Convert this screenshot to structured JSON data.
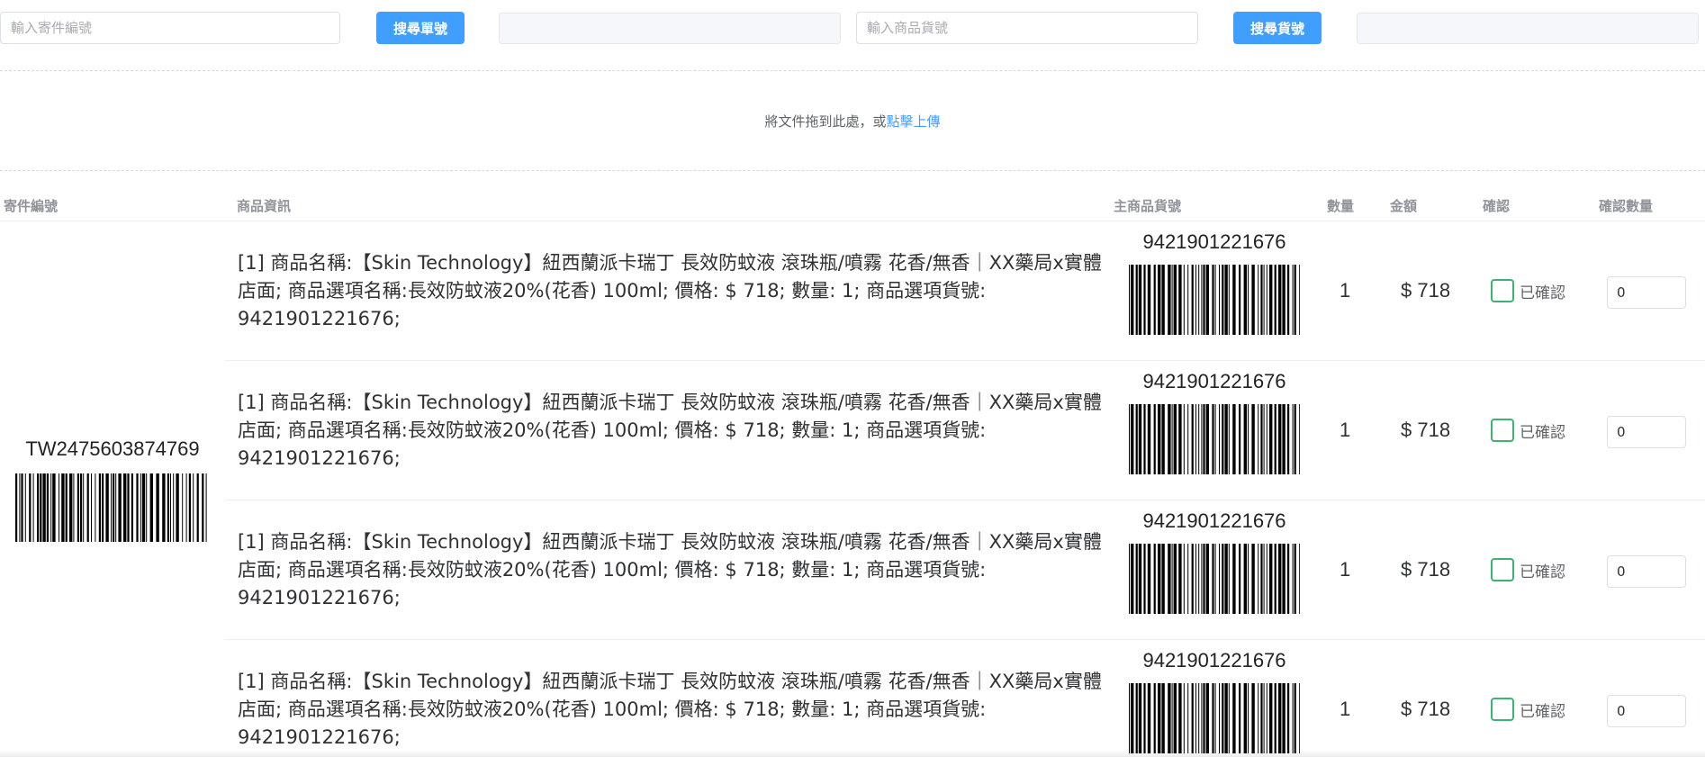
{
  "search": {
    "shipment_placeholder": "輸入寄件編號",
    "shipment_button": "搜尋單號",
    "sku_placeholder": "輸入商品貨號",
    "sku_button": "搜尋貨號"
  },
  "upload": {
    "hint": "將文件拖到此處，或",
    "link": "點擊上傳"
  },
  "table": {
    "headers": {
      "shipment_no": "寄件編號",
      "product_info": "商品資訊",
      "main_sku": "主商品貨號",
      "quantity": "數量",
      "amount": "金額",
      "confirm": "確認",
      "confirm_qty": "確認數量"
    },
    "shipment_number": "TW2475603874769",
    "rows": [
      {
        "info": "[1] 商品名稱:【Skin Technology】紐西蘭派卡瑞丁 長效防蚊液 滾珠瓶/噴霧 花香/無香｜XX藥局x實體店面; 商品選項名稱:長效防蚊液20%(花香) 100ml; 價格: $ 718; 數量: 1; 商品選項貨號: 9421901221676;",
        "sku": "9421901221676",
        "qty": "1",
        "amount": "$ 718",
        "confirm_label": "已確認",
        "confirm_qty": "0"
      },
      {
        "info": "[1] 商品名稱:【Skin Technology】紐西蘭派卡瑞丁 長效防蚊液 滾珠瓶/噴霧 花香/無香｜XX藥局x實體店面; 商品選項名稱:長效防蚊液20%(花香) 100ml; 價格: $ 718; 數量: 1; 商品選項貨號: 9421901221676;",
        "sku": "9421901221676",
        "qty": "1",
        "amount": "$ 718",
        "confirm_label": "已確認",
        "confirm_qty": "0"
      },
      {
        "info": "[1] 商品名稱:【Skin Technology】紐西蘭派卡瑞丁 長效防蚊液 滾珠瓶/噴霧 花香/無香｜XX藥局x實體店面; 商品選項名稱:長效防蚊液20%(花香) 100ml; 價格: $ 718; 數量: 1; 商品選項貨號: 9421901221676;",
        "sku": "9421901221676",
        "qty": "1",
        "amount": "$ 718",
        "confirm_label": "已確認",
        "confirm_qty": "0"
      },
      {
        "info": "[1] 商品名稱:【Skin Technology】紐西蘭派卡瑞丁 長效防蚊液 滾珠瓶/噴霧 花香/無香｜XX藥局x實體店面; 商品選項名稱:長效防蚊液20%(花香) 100ml; 價格: $ 718; 數量: 1; 商品選項貨號: 9421901221676;",
        "sku": "9421901221676",
        "qty": "1",
        "amount": "$ 718",
        "confirm_label": "已確認",
        "confirm_qty": "0"
      }
    ]
  },
  "colors": {
    "primary": "#409eff",
    "checkbox_border": "#3cb371",
    "header_text": "#909399"
  }
}
